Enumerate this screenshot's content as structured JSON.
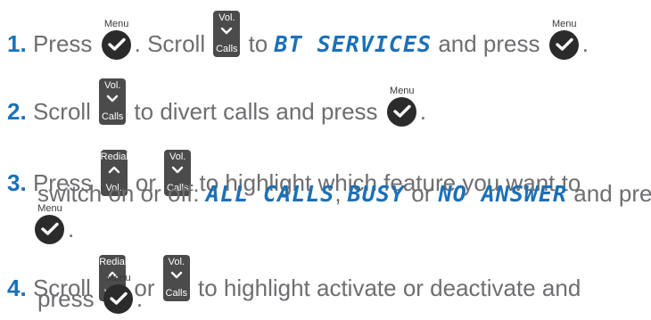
{
  "steps": [
    {
      "number": "1",
      "dot": ".",
      "parts": [
        "Press",
        ". Scroll",
        "to",
        "and press",
        "."
      ],
      "lcd": "BT SERVICES"
    },
    {
      "number": "2",
      "dot": ".",
      "parts": [
        "Scroll",
        "to divert calls and press",
        "."
      ]
    },
    {
      "number": "3",
      "dot": ".",
      "parts": [
        "Press",
        "or",
        "to highlight which feature you want to",
        "switch on or off:",
        ",",
        "or",
        "and press",
        "."
      ],
      "lcd": [
        "ALL CALLS",
        "BUSY",
        "NO ANSWER"
      ]
    },
    {
      "number": "4",
      "dot": ".",
      "parts": [
        "Scroll",
        "or",
        "to highlight activate or deactivate and",
        "press",
        "."
      ]
    }
  ],
  "keys": {
    "menu": "Menu",
    "vol": "Vol.",
    "calls": "Calls",
    "redial": "Redial"
  },
  "colors": {
    "number": "#1c70b7",
    "lcd_text": "#1c70b7",
    "body_text": "#6d6e71",
    "key": "#2b2b2b"
  }
}
